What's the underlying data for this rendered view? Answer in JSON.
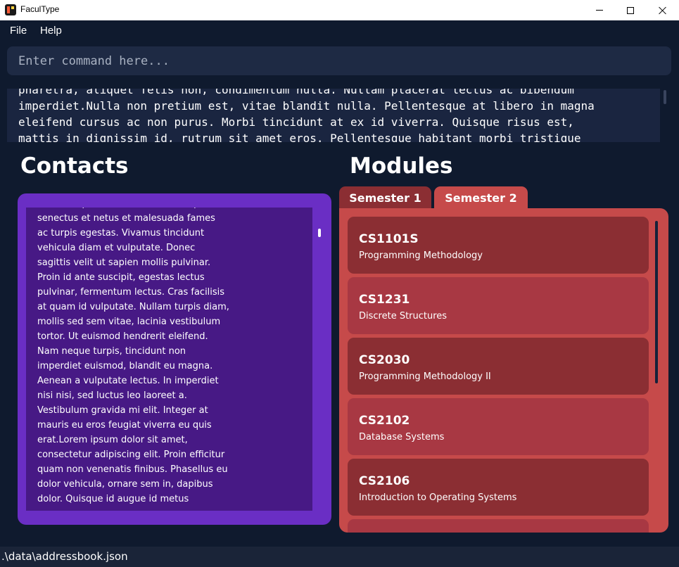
{
  "window": {
    "title": "FaculType"
  },
  "menu": {
    "items": [
      "File",
      "Help"
    ]
  },
  "command": {
    "placeholder": "Enter command here..."
  },
  "result": {
    "text": "pharetra, aliquet felis non, condimentum nulla. Nullam placerat lectus ac bibendum\nimperdiet.Nulla non pretium est, vitae blandit nulla. Pellentesque at libero in magna\neleifend cursus ac non purus. Morbi tincidunt at ex id viverra. Quisque risus est,\nmattis in dignissim id, rutrum sit amet eros. Pellentesque habitant morbi tristique"
  },
  "contacts": {
    "heading": "Contacts",
    "text": "Pellentesque habitant morbi tristique\nsenectus et netus et malesuada fames\nac turpis egestas. Vivamus tincidunt\nvehicula diam et vulputate. Donec\nsagittis velit ut sapien mollis pulvinar.\nProin id ante suscipit, egestas lectus\npulvinar, fermentum lectus. Cras facilisis\nat quam id vulputate. Nullam turpis diam,\nmollis sed sem vitae, lacinia vestibulum\ntortor. Ut euismod hendrerit eleifend.\nNam neque turpis, tincidunt non\nimperdiet euismod, blandit eu magna.\nAenean a vulputate lectus. In imperdiet\nnisi nisi, sed luctus leo laoreet a.\nVestibulum gravida mi elit. Integer at\nmauris eu eros feugiat viverra eu quis\nerat.Lorem ipsum dolor sit amet,\nconsectetur adipiscing elit. Proin efficitur\nquam non venenatis finibus. Phasellus eu\ndolor vehicula, ornare sem in, dapibus\ndolor. Quisque id augue id metus"
  },
  "modules": {
    "heading": "Modules",
    "tabs": [
      {
        "label": "Semester 1",
        "selected": false
      },
      {
        "label": "Semester 2",
        "selected": true
      }
    ],
    "items": [
      {
        "code": "CS1101S",
        "name": "Programming Methodology"
      },
      {
        "code": "CS1231",
        "name": "Discrete Structures"
      },
      {
        "code": "CS2030",
        "name": "Programming Methodology II"
      },
      {
        "code": "CS2102",
        "name": "Database Systems"
      },
      {
        "code": "CS2106",
        "name": "Introduction to Operating Systems"
      }
    ]
  },
  "status": {
    "path": ".\\data\\addressbook.json"
  },
  "colors": {
    "background": "#0f1a2e",
    "contacts_panel": "#6a2ec4",
    "contact_card": "#471985",
    "modules_panel": "#c64a4a",
    "module_card_dark": "#8b2e33",
    "module_card_light": "#a83843"
  }
}
